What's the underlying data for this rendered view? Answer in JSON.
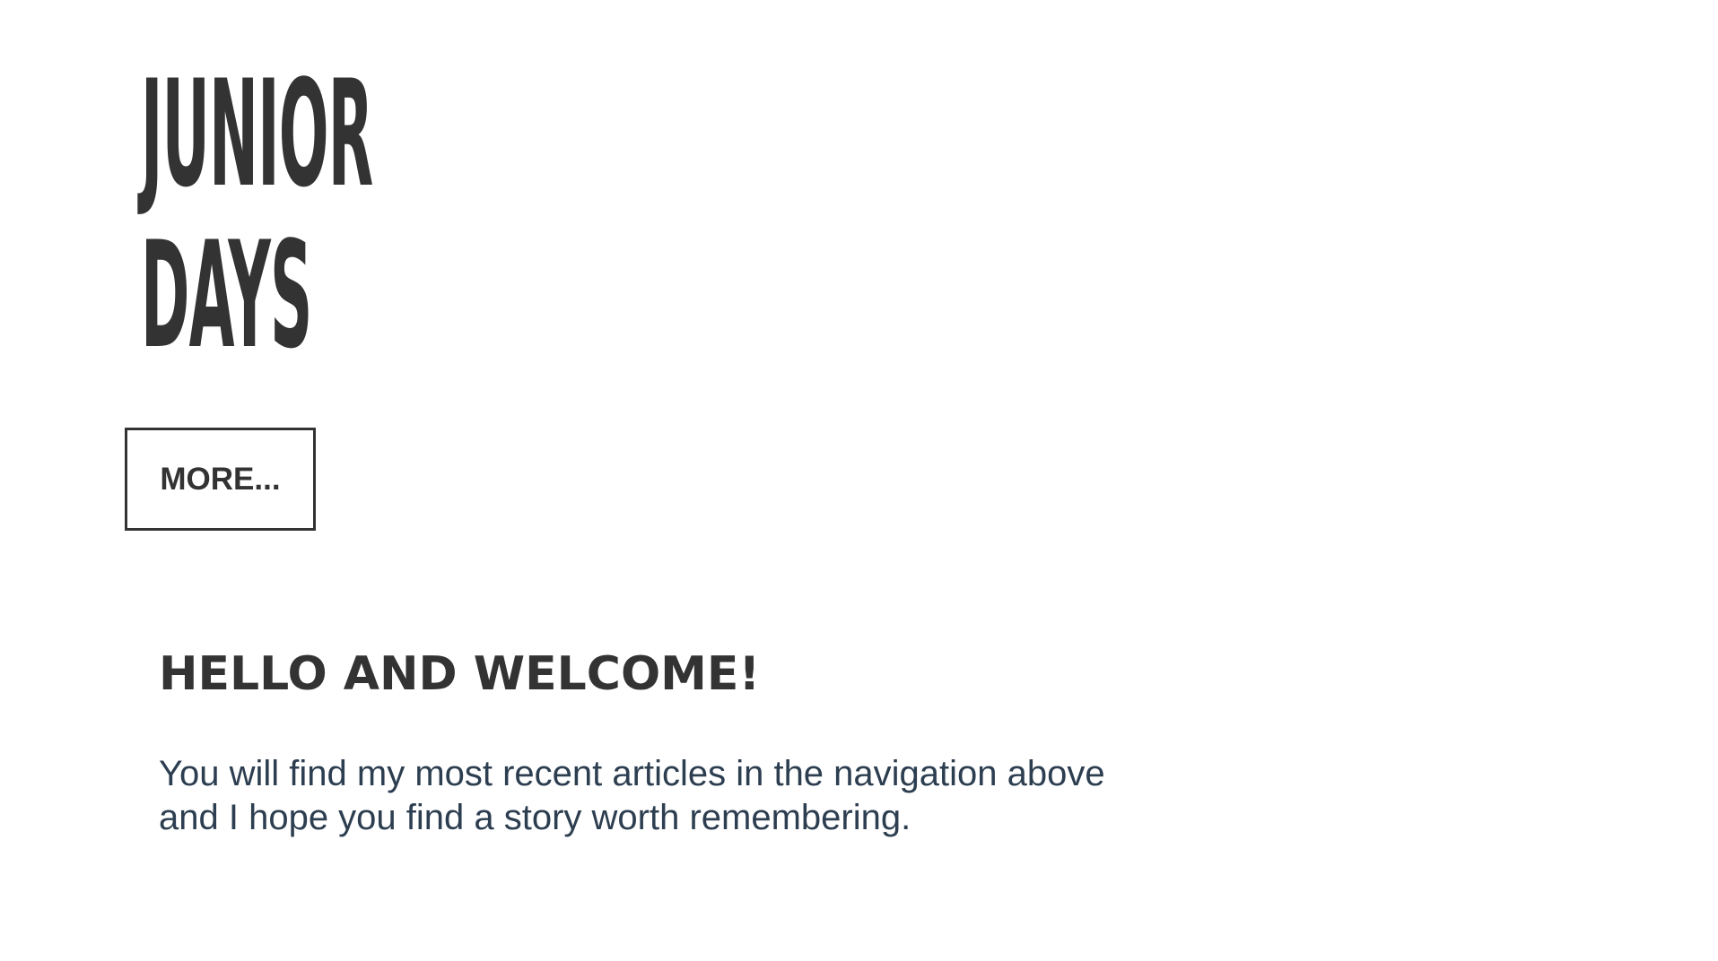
{
  "header": {
    "title_line_1": "JUNIOR",
    "title_line_2": "DAYS",
    "more_button_label": "MORE..."
  },
  "main": {
    "heading": "HELLO AND WELCOME!",
    "paragraph": "You will find my most recent articles in the navigation above and I hope you find a story worth remembering."
  },
  "colors": {
    "text_dark": "#333333",
    "paragraph_text": "#2c3e50",
    "background": "#ffffff"
  }
}
